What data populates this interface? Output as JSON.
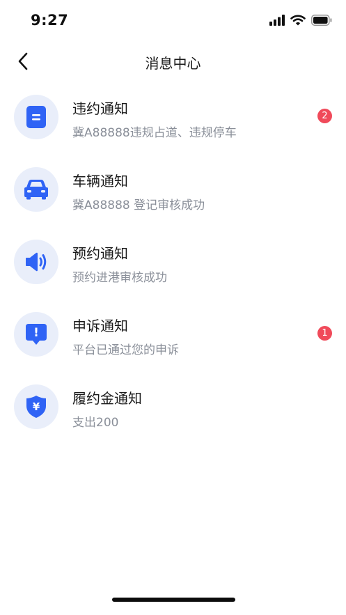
{
  "status_bar": {
    "time": "9:27"
  },
  "header": {
    "title": "消息中心"
  },
  "accent_color": "#2f63f5",
  "badge_color": "#f04a5a",
  "messages": [
    {
      "icon": "document-icon",
      "title": "违约通知",
      "subtitle": "冀A88888违规占道、违规停车",
      "badge": "2"
    },
    {
      "icon": "car-icon",
      "title": "车辆通知",
      "subtitle": "冀A88888 登记审核成功",
      "badge": ""
    },
    {
      "icon": "speaker-icon",
      "title": "预约通知",
      "subtitle": "预约进港审核成功",
      "badge": ""
    },
    {
      "icon": "alert-icon",
      "title": "申诉通知",
      "subtitle": "平台已通过您的申诉",
      "badge": "1"
    },
    {
      "icon": "yuan-shield-icon",
      "title": "履约金通知",
      "subtitle": "支出200",
      "badge": ""
    }
  ],
  "shield_glyph": "¥",
  "alert_glyph": "!"
}
